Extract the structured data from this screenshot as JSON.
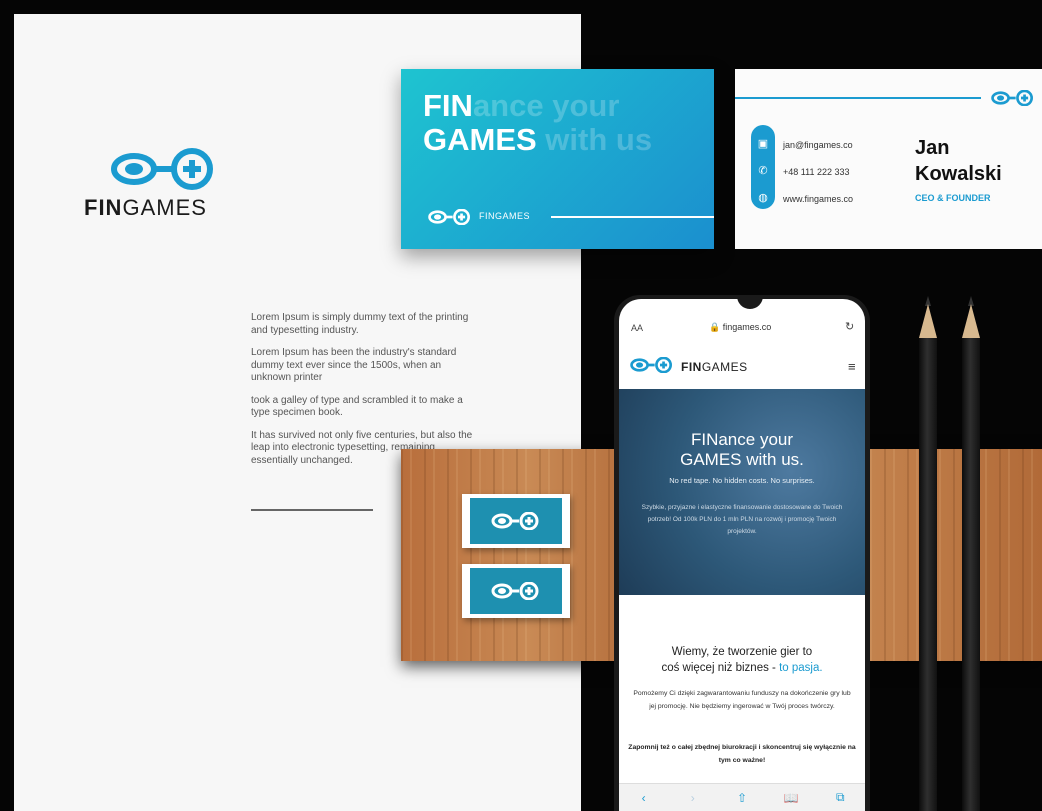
{
  "brand": {
    "name_bold": "FIN",
    "name_light": "GAMES",
    "accent_color": "#1b9bd0",
    "logo_icon": "fingames-logo-icon"
  },
  "letterhead": {
    "paragraphs": [
      "Lorem Ipsum is simply dummy text of the printing and typesetting industry.",
      "Lorem Ipsum has been the industry's standard dummy text ever since the 1500s, when an unknown printer",
      "took a galley of type and scrambled it to make a type specimen book.",
      "It has survived not only five centuries, but also the leap into electronic typesetting, remaining essentially unchanged."
    ]
  },
  "blue_card": {
    "line1_bold": "FIN",
    "line1_rest": "ance your",
    "line2_bold": "GAMES",
    "line2_rest": " with us",
    "footer_brand": "FINGAMES"
  },
  "business_card": {
    "email": "jan@fingames.co",
    "phone": "+48 111 222 333",
    "website": "www.fingames.co",
    "first_name": "Jan",
    "last_name": "Kowalski",
    "role": "CEO & FOUNDER",
    "icons": [
      "id-card-icon",
      "phone-icon",
      "globe-icon"
    ]
  },
  "phone": {
    "aa": "AA",
    "url": "🔒 fingames.co",
    "reload": "↻",
    "menu": "≡",
    "hero_line1": "FINance your",
    "hero_line2": "GAMES with us.",
    "hero_sub": "No red tape. No hidden costs. No surprises.",
    "hero_para": "Szybkie, przyjazne i elastyczne finansowanie dostosowane do Twoich potrzeb! Od 100k PLN do 1 mln PLN na rozwój i promocję Twoich projektów.",
    "section_line1": "Wiemy, że tworzenie gier to",
    "section_line2": "coś więcej niż biznes - ",
    "section_accent": "to pasja.",
    "body": "Pomożemy Ci dzięki zagwarantowaniu funduszy na dokończenie gry lub jej promocję. Nie będziemy ingerować w Twój proces twórczy.",
    "bold_text": "Zapomnij też o całej zbędnej biurokracji i skoncentruj się wyłącznie na tym co ważne!",
    "nav": [
      "‹",
      "›",
      "⇧",
      "📖",
      "⧉"
    ]
  }
}
